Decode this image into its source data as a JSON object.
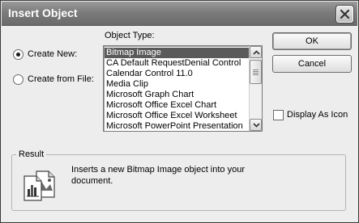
{
  "window": {
    "title": "Insert Object"
  },
  "options": {
    "create_new_label": "Create New:",
    "create_new_selected": true,
    "create_from_file_label": "Create from File:",
    "create_from_file_selected": false
  },
  "object_type": {
    "label": "Object Type:",
    "items": [
      "Bitmap Image",
      "CA Default RequestDenial Control",
      "Calendar Control 11.0",
      "Media Clip",
      "Microsoft Graph Chart",
      "Microsoft Office Excel Chart",
      "Microsoft Office Excel Worksheet",
      "Microsoft PowerPoint Presentation"
    ],
    "selected": "Bitmap Image"
  },
  "buttons": {
    "ok_label": "OK",
    "cancel_label": "Cancel"
  },
  "display_as_icon": {
    "label": "Display As Icon",
    "checked": false
  },
  "result": {
    "legend": "Result",
    "text": "Inserts a new Bitmap Image object into your document."
  },
  "icons": {
    "close": "close-icon",
    "result": "bitmap-document-icon"
  },
  "colors": {
    "titlebar": "#7c7c7c",
    "selection": "#5a5a5a",
    "dialog_bg": "#ededed"
  }
}
